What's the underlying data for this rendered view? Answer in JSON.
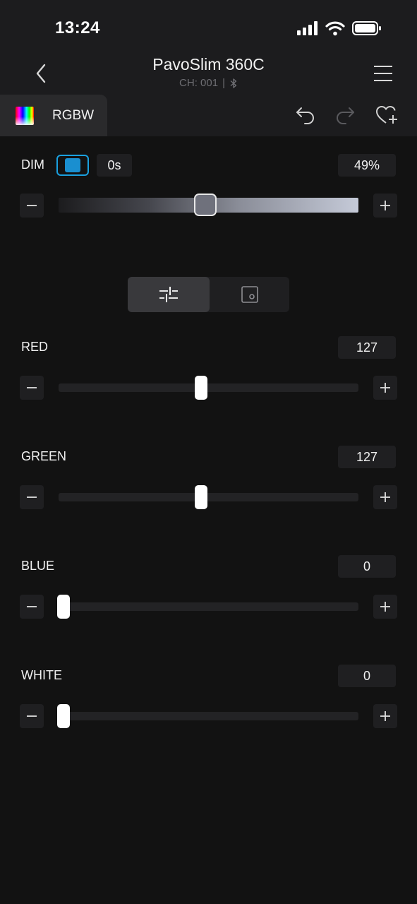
{
  "status_bar": {
    "time": "13:24"
  },
  "header": {
    "title": "PavoSlim 360C",
    "channel": "CH: 001",
    "separator": "|"
  },
  "tab": {
    "label": "RGBW"
  },
  "dim": {
    "label": "DIM",
    "fade_time": "0s",
    "value": "49%",
    "level_fraction": 0.49,
    "toggle_on": true
  },
  "mode_segment": {
    "options": [
      "sliders-icon",
      "color-picker-icon"
    ],
    "selected": "sliders-icon"
  },
  "channels": [
    {
      "label": "RED",
      "value": "127",
      "level": 127,
      "max": 255
    },
    {
      "label": "GREEN",
      "value": "127",
      "level": 127,
      "max": 255
    },
    {
      "label": "BLUE",
      "value": "0",
      "level": 0,
      "max": 255
    },
    {
      "label": "WHITE",
      "value": "0",
      "level": 0,
      "max": 255
    }
  ],
  "colors": {
    "background": "#121212",
    "header": "#1c1c1e",
    "accent": "#1a8fd0"
  },
  "icons": {
    "back": "chevron-left-icon",
    "menu": "hamburger-icon",
    "undo": "undo-icon",
    "redo": "redo-icon",
    "favorite": "heart-add-icon",
    "bluetooth": "bluetooth-icon"
  }
}
